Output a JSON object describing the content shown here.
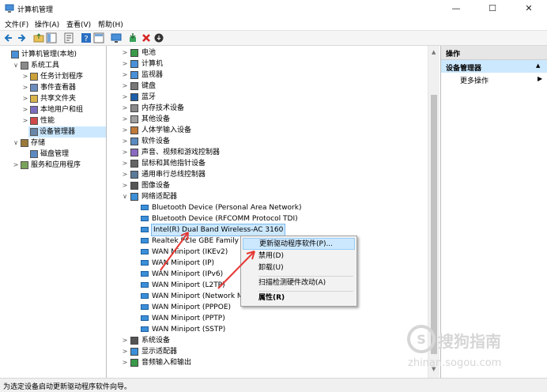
{
  "window": {
    "title": "计算机管理",
    "controls": {
      "minimize": "—",
      "maximize": "☐",
      "close": "✕"
    }
  },
  "menubar": [
    "文件(F)",
    "操作(A)",
    "查看(V)",
    "帮助(H)"
  ],
  "toolbar": {
    "icons": [
      "back-arrow-icon",
      "forward-arrow-icon",
      "up-folder-icon",
      "show-tree-icon",
      "properties-icon",
      "help-icon",
      "console-icon",
      "update-driver-icon",
      "uninstall-icon",
      "disable-icon"
    ]
  },
  "left_tree": [
    {
      "label": "计算机管理(本地)",
      "level": 0,
      "expander": "",
      "icon": "computer-management-icon"
    },
    {
      "label": "系统工具",
      "level": 1,
      "expander": "∨",
      "icon": "tools-icon"
    },
    {
      "label": "任务计划程序",
      "level": 2,
      "expander": ">",
      "icon": "clock-icon"
    },
    {
      "label": "事件查看器",
      "level": 2,
      "expander": ">",
      "icon": "event-viewer-icon"
    },
    {
      "label": "共享文件夹",
      "level": 2,
      "expander": ">",
      "icon": "shared-folder-icon"
    },
    {
      "label": "本地用户和组",
      "level": 2,
      "expander": ">",
      "icon": "users-icon"
    },
    {
      "label": "性能",
      "level": 2,
      "expander": ">",
      "icon": "performance-icon"
    },
    {
      "label": "设备管理器",
      "level": 2,
      "expander": "",
      "icon": "device-manager-icon",
      "selected": true
    },
    {
      "label": "存储",
      "level": 1,
      "expander": "∨",
      "icon": "storage-icon"
    },
    {
      "label": "磁盘管理",
      "level": 2,
      "expander": "",
      "icon": "disk-icon"
    },
    {
      "label": "服务和应用程序",
      "level": 1,
      "expander": ">",
      "icon": "services-icon"
    }
  ],
  "device_tree": [
    {
      "label": "电池",
      "level": 0,
      "expander": ">",
      "icon": "battery-icon"
    },
    {
      "label": "计算机",
      "level": 0,
      "expander": ">",
      "icon": "computer-icon"
    },
    {
      "label": "监视器",
      "level": 0,
      "expander": ">",
      "icon": "monitor-icon"
    },
    {
      "label": "键盘",
      "level": 0,
      "expander": ">",
      "icon": "keyboard-icon"
    },
    {
      "label": "蓝牙",
      "level": 0,
      "expander": ">",
      "icon": "bluetooth-icon"
    },
    {
      "label": "内存技术设备",
      "level": 0,
      "expander": ">",
      "icon": "memory-icon"
    },
    {
      "label": "其他设备",
      "level": 0,
      "expander": ">",
      "icon": "other-device-icon"
    },
    {
      "label": "人体学输入设备",
      "level": 0,
      "expander": ">",
      "icon": "hid-icon"
    },
    {
      "label": "软件设备",
      "level": 0,
      "expander": ">",
      "icon": "software-device-icon"
    },
    {
      "label": "声音、视频和游戏控制器",
      "level": 0,
      "expander": ">",
      "icon": "sound-icon"
    },
    {
      "label": "鼠标和其他指针设备",
      "level": 0,
      "expander": ">",
      "icon": "mouse-icon"
    },
    {
      "label": "通用串行总线控制器",
      "level": 0,
      "expander": ">",
      "icon": "usb-icon"
    },
    {
      "label": "图像设备",
      "level": 0,
      "expander": ">",
      "icon": "camera-icon"
    },
    {
      "label": "网络适配器",
      "level": 0,
      "expander": "∨",
      "icon": "network-adapter-icon"
    },
    {
      "label": "Bluetooth Device (Personal Area Network)",
      "level": 1,
      "expander": "",
      "icon": "network-card-icon"
    },
    {
      "label": "Bluetooth Device (RFCOMM Protocol TDI)",
      "level": 1,
      "expander": "",
      "icon": "network-card-icon"
    },
    {
      "label": "Intel(R) Dual Band Wireless-AC 3160",
      "level": 1,
      "expander": "",
      "icon": "network-card-icon",
      "highlighted": true
    },
    {
      "label": "Realtek PCIe GBE Family C",
      "level": 1,
      "expander": "",
      "icon": "network-card-icon"
    },
    {
      "label": "WAN Miniport (IKEv2)",
      "level": 1,
      "expander": "",
      "icon": "network-card-icon"
    },
    {
      "label": "WAN Miniport (IP)",
      "level": 1,
      "expander": "",
      "icon": "network-card-icon"
    },
    {
      "label": "WAN Miniport (IPv6)",
      "level": 1,
      "expander": "",
      "icon": "network-card-icon"
    },
    {
      "label": "WAN Miniport (L2TP)",
      "level": 1,
      "expander": "",
      "icon": "network-card-icon"
    },
    {
      "label": "WAN Miniport (Network M",
      "level": 1,
      "expander": "",
      "icon": "network-card-icon"
    },
    {
      "label": "WAN Miniport (PPPOE)",
      "level": 1,
      "expander": "",
      "icon": "network-card-icon"
    },
    {
      "label": "WAN Miniport (PPTP)",
      "level": 1,
      "expander": "",
      "icon": "network-card-icon"
    },
    {
      "label": "WAN Miniport (SSTP)",
      "level": 1,
      "expander": "",
      "icon": "network-card-icon"
    },
    {
      "label": "系统设备",
      "level": 0,
      "expander": ">",
      "icon": "system-device-icon"
    },
    {
      "label": "显示适配器",
      "level": 0,
      "expander": ">",
      "icon": "display-adapter-icon"
    },
    {
      "label": "音频输入和输出",
      "level": 0,
      "expander": ">",
      "icon": "audio-icon"
    }
  ],
  "context_menu": [
    {
      "label": "更新驱动程序软件(P)...",
      "highlighted": true
    },
    {
      "label": "禁用(D)"
    },
    {
      "label": "卸载(U)"
    },
    {
      "separator": true
    },
    {
      "label": "扫描检测硬件改动(A)"
    },
    {
      "separator": true
    },
    {
      "label": "属性(R)",
      "bold": true
    }
  ],
  "actions_pane": {
    "header": "操作",
    "section": "设备管理器",
    "section_arrow": "▲",
    "more": "更多操作",
    "more_arrow": "▶"
  },
  "statusbar": {
    "text": "为选定设备启动更新驱动程序软件向导。"
  },
  "watermark": {
    "logo_text": "搜狗指南",
    "url": "zhinan.sogou.com"
  },
  "colors": {
    "selection": "#cce8ff",
    "accent": "#0078d7",
    "annotation": "#e53935",
    "actions_header": "#e6e6e6"
  }
}
